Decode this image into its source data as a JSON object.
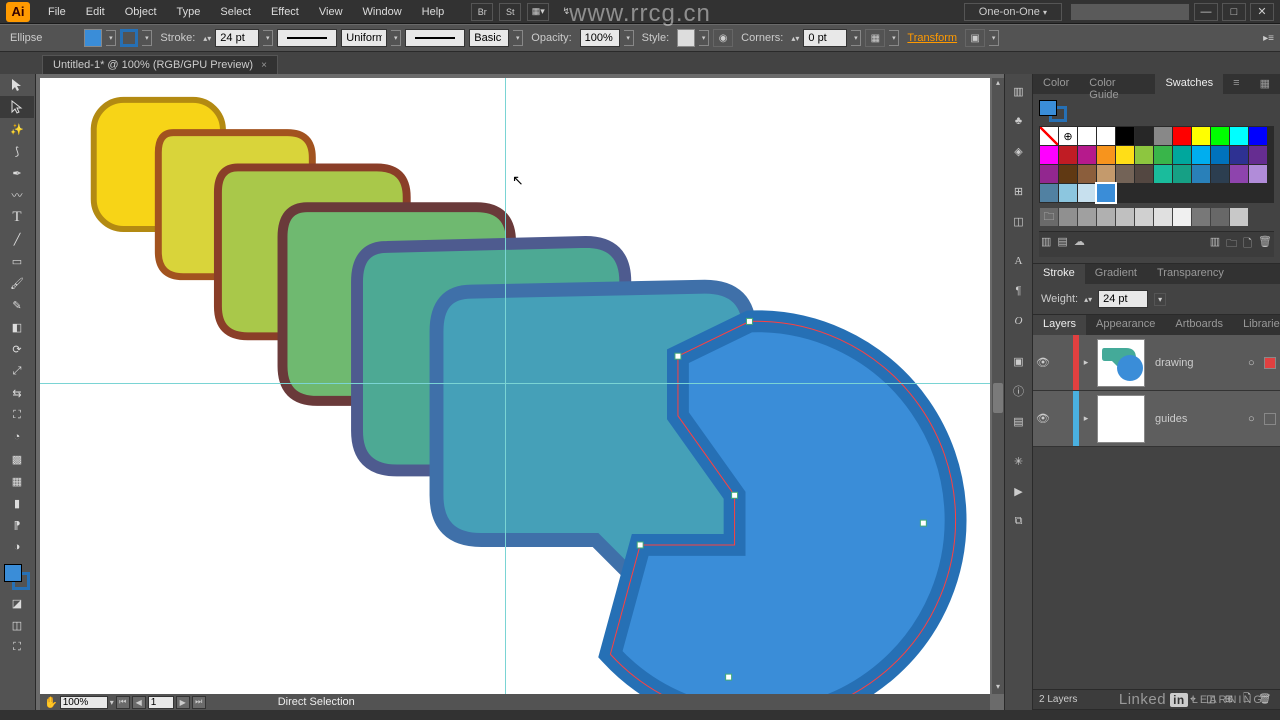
{
  "menu": {
    "items": [
      "File",
      "Edit",
      "Object",
      "Type",
      "Select",
      "Effect",
      "View",
      "Window",
      "Help"
    ],
    "workspace": "One-on-One",
    "search_placeholder": ""
  },
  "window_controls": {
    "min": "—",
    "max": "□",
    "close": "✕"
  },
  "control": {
    "shape": "Ellipse",
    "stroke_label": "Stroke:",
    "stroke_weight": "24 pt",
    "stroke_profile": "Uniform",
    "brush": "Basic",
    "opacity_label": "Opacity:",
    "opacity": "100%",
    "style_label": "Style:",
    "corners_label": "Corners:",
    "corners": "0 pt",
    "transform": "Transform"
  },
  "tab": {
    "title": "Untitled-1* @ 100% (RGB/GPU Preview)",
    "close": "×"
  },
  "status": {
    "zoom": "100%",
    "page": "1",
    "mode": "Direct Selection"
  },
  "panels": {
    "swatches_tabs": [
      "Color",
      "Color Guide",
      "Swatches"
    ],
    "stroke_tabs": [
      "Stroke",
      "Gradient",
      "Transparency"
    ],
    "stroke_weight_label": "Weight:",
    "stroke_weight": "24 pt",
    "layers_tabs": [
      "Layers",
      "Appearance",
      "Artboards",
      "Libraries"
    ],
    "layers": [
      {
        "name": "drawing",
        "color": "#e04040",
        "selected": true
      },
      {
        "name": "guides",
        "color": "#4ab0e0",
        "selected": false
      }
    ],
    "layers_count": "2 Layers"
  },
  "swatch_colors": [
    "#ffffff",
    "#ffffff",
    "#000000",
    "#272727",
    "#888888",
    "#ff0000",
    "#ffff00",
    "#00ff00",
    "#00ffff",
    "#0000ff",
    "#ff00ff",
    "#c01c24",
    "#b61a8c",
    "#f7941d",
    "#ffde17",
    "#8dc63f",
    "#39b54a",
    "#00a79d",
    "#00aeef",
    "#0072bc",
    "#2e3192",
    "#662d91",
    "#92278f",
    "#603913",
    "#8b5e3c",
    "#c49a6c",
    "#736357",
    "#534741",
    "#1abc9c",
    "#16a085",
    "#2980b9",
    "#2c3e50",
    "#8e44ad",
    "#b18cd9",
    "#5181a2",
    "#8cc6df",
    "#c7e0ee"
  ],
  "folder_swatches": [
    "#909090",
    "#a0a0a0",
    "#b0b0b0",
    "#c0c0c0",
    "#d0d0d0",
    "#e0e0e0",
    "#f0f0f0",
    "#787878",
    "#686868",
    "#c8c8c8"
  ],
  "watermark": {
    "url": "www.rrcg.cn",
    "brand_pre": "Linked",
    "brand_in": "in",
    "brand_post": "LEARNING"
  }
}
